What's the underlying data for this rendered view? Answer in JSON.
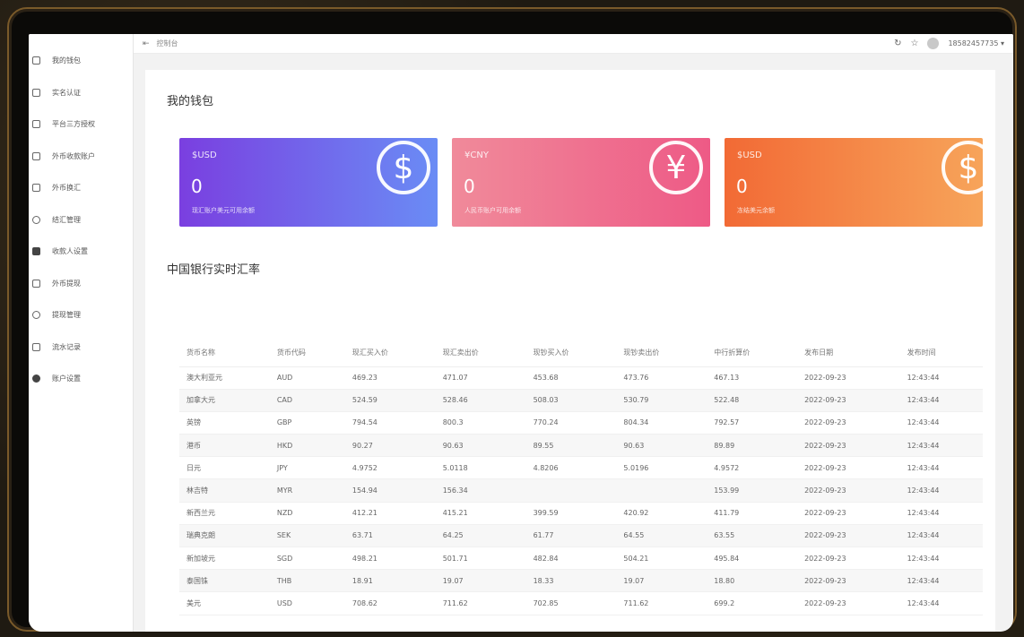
{
  "sidebar": {
    "items": [
      {
        "label": "我的钱包",
        "icon": "wallet-icon"
      },
      {
        "label": "实名认证",
        "icon": "id-card-icon"
      },
      {
        "label": "平台三方授权",
        "icon": "document-icon"
      },
      {
        "label": "外币收款账户",
        "icon": "bank-card-icon"
      },
      {
        "label": "外币换汇",
        "icon": "exchange-icon"
      },
      {
        "label": "结汇管理",
        "icon": "user-icon"
      },
      {
        "label": "收款人设置",
        "icon": "contact-icon"
      },
      {
        "label": "外币提现",
        "icon": "withdraw-icon"
      },
      {
        "label": "提现管理",
        "icon": "user-icon"
      },
      {
        "label": "流水记录",
        "icon": "record-icon"
      },
      {
        "label": "账户设置",
        "icon": "gear-icon"
      }
    ]
  },
  "header": {
    "breadcrumb": "控制台",
    "username": "18582457735",
    "icons": [
      "menu-toggle-icon",
      "refresh-icon",
      "star-icon",
      "avatar-icon"
    ]
  },
  "main": {
    "page_title": "我的钱包",
    "cards": [
      {
        "currency": "$USD",
        "value": "0",
        "desc": "现汇账户美元可用余额",
        "symbol": "$"
      },
      {
        "currency": "¥CNY",
        "value": "0",
        "desc": "人民币账户可用余额",
        "symbol": "¥"
      },
      {
        "currency": "$USD",
        "value": "0",
        "desc": "冻结美元余额",
        "symbol": "$"
      }
    ],
    "section_title": "中国银行实时汇率",
    "table": {
      "headers": [
        "货币名称",
        "货币代码",
        "现汇买入价",
        "现汇卖出价",
        "现钞买入价",
        "现钞卖出价",
        "中行折算价",
        "发布日期",
        "发布时间"
      ],
      "rows": [
        [
          "澳大利亚元",
          "AUD",
          "469.23",
          "471.07",
          "453.68",
          "473.76",
          "467.13",
          "2022-09-23",
          "12:43:44"
        ],
        [
          "加拿大元",
          "CAD",
          "524.59",
          "528.46",
          "508.03",
          "530.79",
          "522.48",
          "2022-09-23",
          "12:43:44"
        ],
        [
          "英镑",
          "GBP",
          "794.54",
          "800.3",
          "770.24",
          "804.34",
          "792.57",
          "2022-09-23",
          "12:43:44"
        ],
        [
          "港币",
          "HKD",
          "90.27",
          "90.63",
          "89.55",
          "90.63",
          "89.89",
          "2022-09-23",
          "12:43:44"
        ],
        [
          "日元",
          "JPY",
          "4.9752",
          "5.0118",
          "4.8206",
          "5.0196",
          "4.9572",
          "2022-09-23",
          "12:43:44"
        ],
        [
          "林吉特",
          "MYR",
          "154.94",
          "156.34",
          "",
          "",
          "153.99",
          "2022-09-23",
          "12:43:44"
        ],
        [
          "新西兰元",
          "NZD",
          "412.21",
          "415.21",
          "399.59",
          "420.92",
          "411.79",
          "2022-09-23",
          "12:43:44"
        ],
        [
          "瑞典克朗",
          "SEK",
          "63.71",
          "64.25",
          "61.77",
          "64.55",
          "63.55",
          "2022-09-23",
          "12:43:44"
        ],
        [
          "新加坡元",
          "SGD",
          "498.21",
          "501.71",
          "482.84",
          "504.21",
          "495.84",
          "2022-09-23",
          "12:43:44"
        ],
        [
          "泰国铢",
          "THB",
          "18.91",
          "19.07",
          "18.33",
          "19.07",
          "18.80",
          "2022-09-23",
          "12:43:44"
        ],
        [
          "美元",
          "USD",
          "708.62",
          "711.62",
          "702.85",
          "711.62",
          "699.2",
          "2022-09-23",
          "12:43:44"
        ]
      ]
    }
  },
  "colors": {
    "card1_gradient": [
      "#7a3fe0",
      "#6a8cf5"
    ],
    "card2_gradient": [
      "#f08a9a",
      "#ee5a86"
    ],
    "card3_gradient": [
      "#f26a35",
      "#f7a45a"
    ]
  }
}
